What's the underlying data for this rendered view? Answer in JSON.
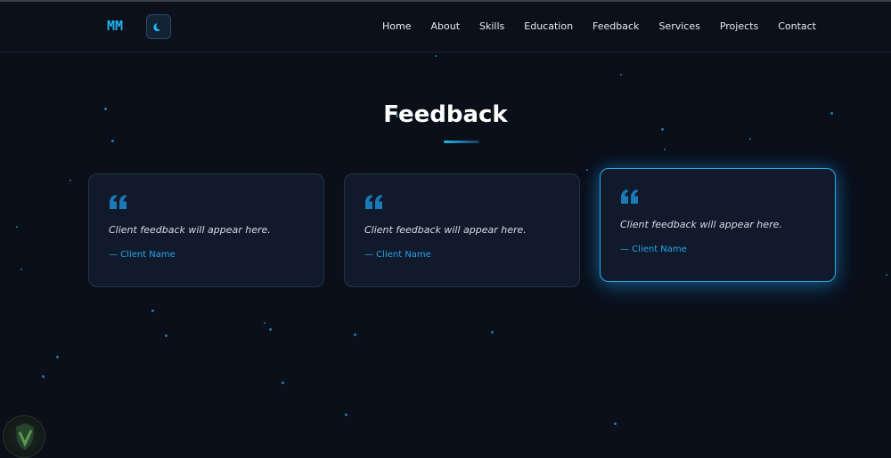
{
  "header": {
    "logo": "MM",
    "theme_toggle_icon": "moon-icon",
    "nav": [
      "Home",
      "About",
      "Skills",
      "Education",
      "Feedback",
      "Services",
      "Projects",
      "Contact"
    ]
  },
  "section": {
    "title": "Feedback"
  },
  "cards": [
    {
      "quote_icon": "quote-icon",
      "text": "Client feedback will appear here.",
      "author": "— Client Name"
    },
    {
      "quote_icon": "quote-icon",
      "text": "Client feedback will appear here.",
      "author": "— Client Name"
    },
    {
      "quote_icon": "quote-icon",
      "text": "Client feedback will appear here.",
      "author": "— Client Name"
    }
  ],
  "colors": {
    "background": "#0a0f1a",
    "accent": "#1fb6f2",
    "card": "#111a2b"
  }
}
